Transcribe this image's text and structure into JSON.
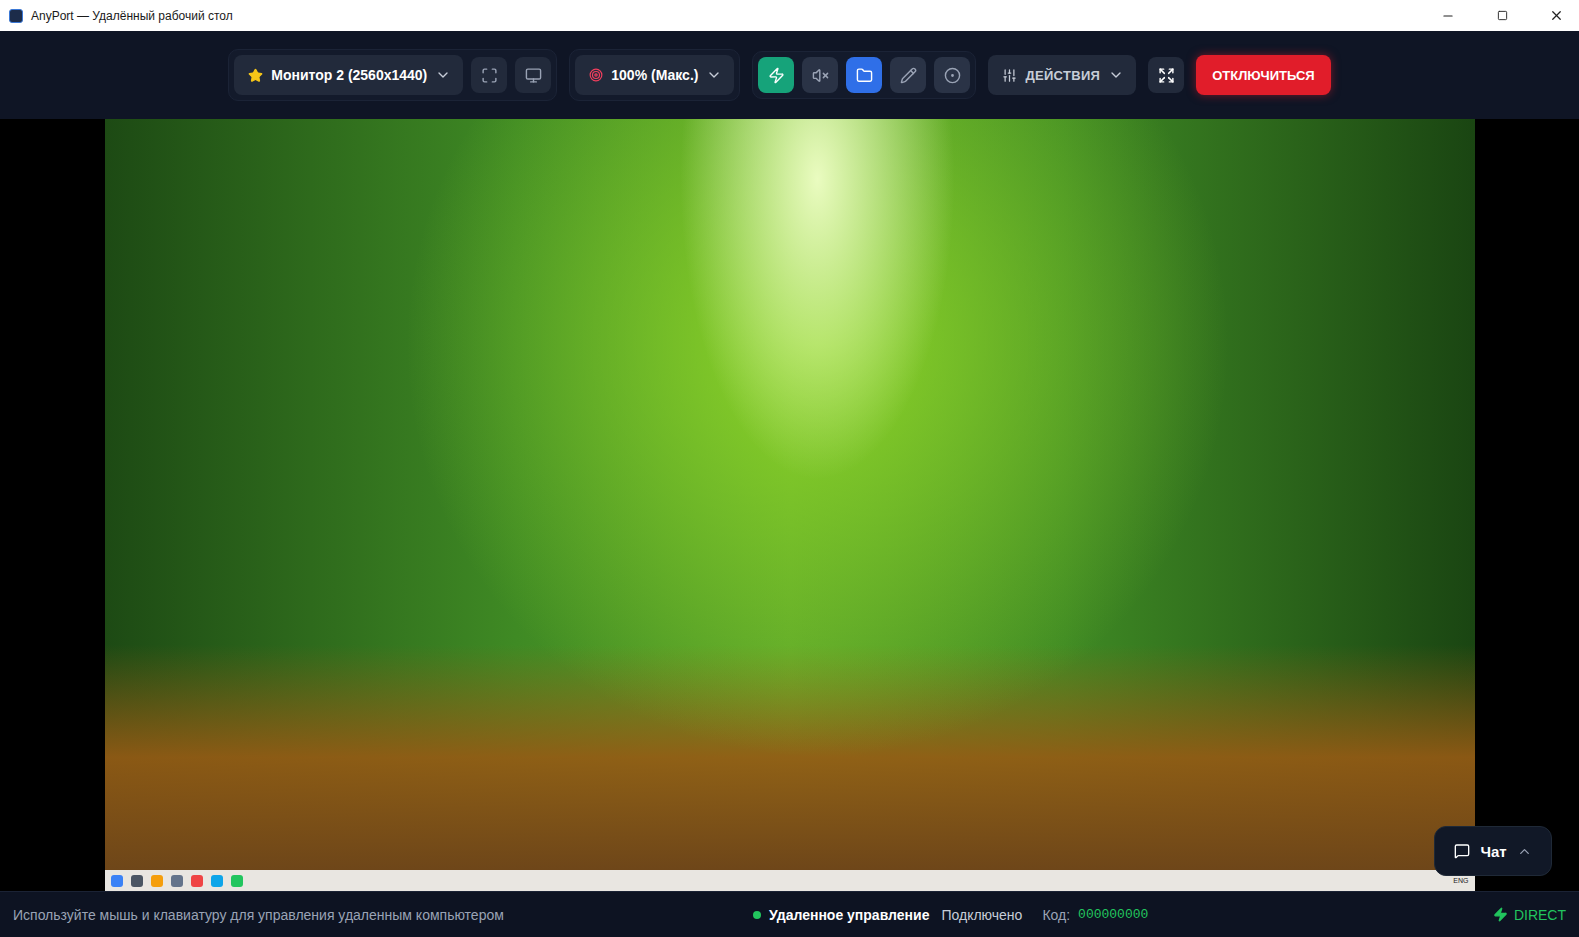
{
  "window": {
    "title": "AnyPort — Удалённый рабочий стол"
  },
  "toolbar": {
    "monitor": {
      "label": "Монитор 2 (2560x1440)"
    },
    "quality": {
      "label": "100% (Макс.)"
    },
    "toggles": [
      {
        "name": "performance",
        "active": true,
        "color": "#16a37a"
      },
      {
        "name": "sound",
        "active": false,
        "color": "#2a3346"
      },
      {
        "name": "files",
        "active": true,
        "color": "#2f6fe8"
      },
      {
        "name": "draw",
        "active": false,
        "color": "#2a3346"
      },
      {
        "name": "record",
        "active": false,
        "color": "#2a3346"
      }
    ],
    "actions": {
      "label": "ДЕЙСТВИЯ"
    },
    "disconnect": {
      "label": "ОТКЛЮЧИТЬСЯ"
    }
  },
  "remote": {
    "taskbar": {
      "language": "ENG"
    }
  },
  "chat": {
    "label": "Чат",
    "expanded": false
  },
  "status_bar": {
    "hint": "Используйте мышь и клавиатуру для управления удаленным компьютером",
    "mode": "Удаленное управление",
    "state": "Подключено",
    "code_label": "Код:",
    "code": "000000000",
    "connection": "DIRECT"
  }
}
